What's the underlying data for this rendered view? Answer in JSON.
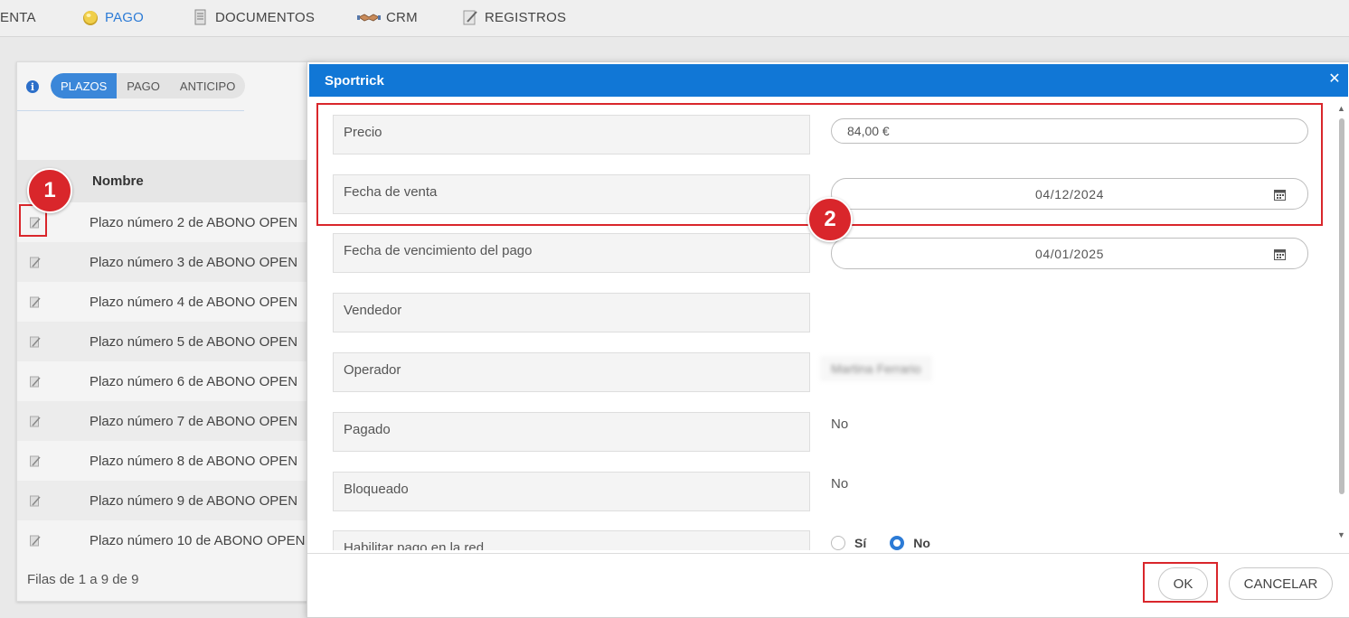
{
  "nav": {
    "items": [
      {
        "label": "ENTA"
      },
      {
        "label": "PAGO"
      },
      {
        "label": "DOCUMENTOS"
      },
      {
        "label": "CRM"
      },
      {
        "label": "REGISTROS"
      }
    ]
  },
  "left_panel": {
    "tabs": [
      "PLAZOS",
      "PAGO",
      "ANTICIPO"
    ],
    "column_header": "Nombre",
    "rows": [
      "Plazo número 2 de ABONO OPEN",
      "Plazo número 3 de ABONO OPEN",
      "Plazo número 4 de ABONO OPEN",
      "Plazo número 5 de ABONO OPEN",
      "Plazo número 6 de ABONO OPEN",
      "Plazo número 7 de ABONO OPEN",
      "Plazo número 8 de ABONO OPEN",
      "Plazo número 9 de ABONO OPEN",
      "Plazo número 10 de ABONO OPEN"
    ],
    "footer": "Filas de 1 a 9 de 9"
  },
  "badges": {
    "step1": "1",
    "step2": "2"
  },
  "dialog": {
    "title": "Sportrick",
    "fields": {
      "precio": {
        "label": "Precio",
        "value": "84,00 €"
      },
      "fecha_venta": {
        "label": "Fecha de venta",
        "value": "04/12/2024"
      },
      "fecha_vencimiento": {
        "label": "Fecha de vencimiento del pago",
        "value": "04/01/2025"
      },
      "vendedor": {
        "label": "Vendedor"
      },
      "operador": {
        "label": "Operador",
        "value": "Martina Ferrario"
      },
      "pagado": {
        "label": "Pagado",
        "value": "No"
      },
      "bloqueado": {
        "label": "Bloqueado",
        "value": "No"
      },
      "habilitar": {
        "label": "Habilitar pago en la red",
        "option_yes": "Sí",
        "option_no": "No",
        "selected": "No"
      }
    },
    "buttons": {
      "ok": "OK",
      "cancel": "CANCELAR"
    }
  },
  "colors": {
    "accent": "#1177d6",
    "tab_active": "#3b87d9",
    "highlight_red": "#d9262b"
  }
}
